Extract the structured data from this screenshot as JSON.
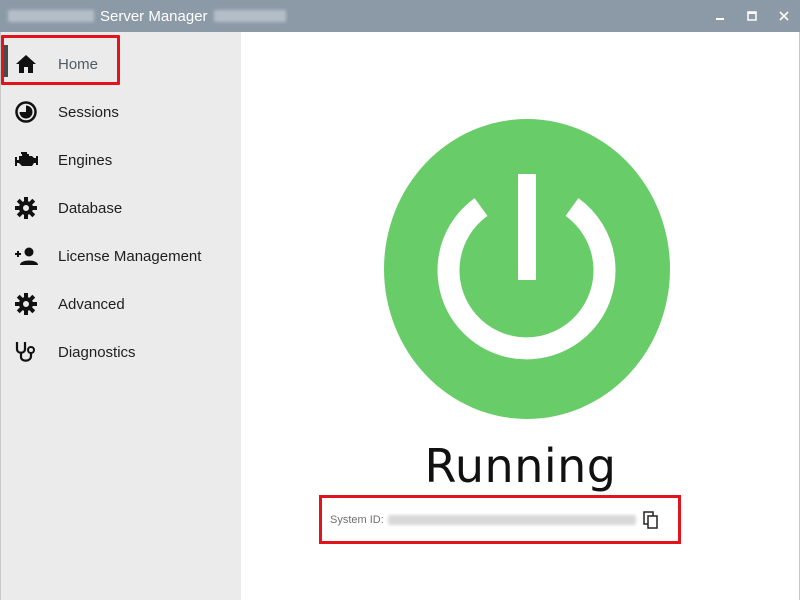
{
  "window": {
    "title": "Server Manager",
    "titlebar_color": "#8c9aa8"
  },
  "sidebar": {
    "items": [
      {
        "label": "Home",
        "icon": "home-icon",
        "active": true
      },
      {
        "label": "Sessions",
        "icon": "clock-pie-icon"
      },
      {
        "label": "Engines",
        "icon": "engine-icon"
      },
      {
        "label": "Database",
        "icon": "gear-icon"
      },
      {
        "label": "License Management",
        "icon": "add-user-icon"
      },
      {
        "label": "Advanced",
        "icon": "gear-icon"
      },
      {
        "label": "Diagnostics",
        "icon": "stethoscope-icon"
      }
    ]
  },
  "main": {
    "status": "Running",
    "status_color": "#68cd68",
    "power_icon": "power-icon",
    "system_id_label": "System ID:"
  },
  "highlight_color": "#e3131b"
}
